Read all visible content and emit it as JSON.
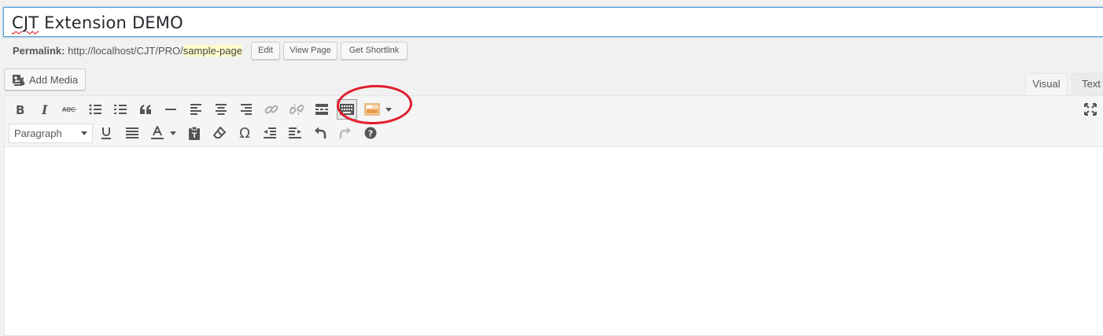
{
  "title": {
    "value_main": "CJT",
    "value_rest": " Extension DEMO"
  },
  "permalink": {
    "label": "Permalink:",
    "base_url": "http://localhost/CJT/PRO/",
    "slug": "sample-page",
    "edit_label": "Edit",
    "view_label": "View Page",
    "shortlink_label": "Get Shortlink"
  },
  "media": {
    "add_label": "Add Media"
  },
  "tabs": {
    "visual": "Visual",
    "text": "Text"
  },
  "toolbar": {
    "format_value": "Paragraph",
    "omega": "Ω",
    "row1_icons": [
      "bold-icon",
      "italic-icon",
      "strikethrough-icon",
      "bulleted-list-icon",
      "numbered-list-icon",
      "blockquote-icon",
      "horizontal-line-icon",
      "align-left-icon",
      "align-center-icon",
      "align-right-icon",
      "link-icon",
      "unlink-icon",
      "read-more-icon",
      "toolbar-toggle-icon",
      "cjt-extension-icon",
      "dropdown-arrow-icon",
      "fullscreen-icon"
    ],
    "row2_icons": [
      "underline-icon",
      "justify-icon",
      "text-color-icon",
      "paste-as-text-icon",
      "clear-formatting-icon",
      "special-character-icon",
      "outdent-icon",
      "indent-icon",
      "undo-icon",
      "redo-icon",
      "help-icon"
    ]
  },
  "annotation": {
    "color": "#e11d2c"
  }
}
